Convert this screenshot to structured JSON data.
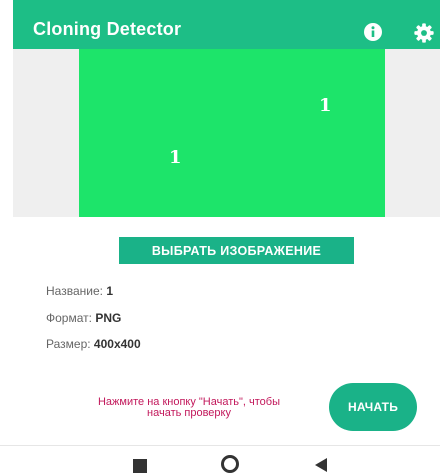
{
  "app_bar": {
    "title": "Cloning Detector",
    "info_icon": "info-icon",
    "settings_icon": "gear-icon",
    "color": "#1DBE86"
  },
  "preview": {
    "background_color": "#1DE46A",
    "overlay_texts": [
      "1",
      "1"
    ]
  },
  "pick_button_label": "ВЫБРАТЬ ИЗОБРАЖЕНИЕ",
  "image_info": {
    "name_label": "Название:",
    "name_value": "1",
    "format_label": "Формат:",
    "format_value": "PNG",
    "size_label": "Размер:",
    "size_value": "400x400"
  },
  "hint": {
    "line1": "Нажмите на кнопку \"Начать\", чтобы",
    "line2": "начать проверку",
    "color": "#C2185B"
  },
  "start_button_label": "НАЧАТЬ",
  "nav_bar": {
    "icons": [
      "recent-apps-icon",
      "home-icon",
      "back-icon"
    ]
  }
}
